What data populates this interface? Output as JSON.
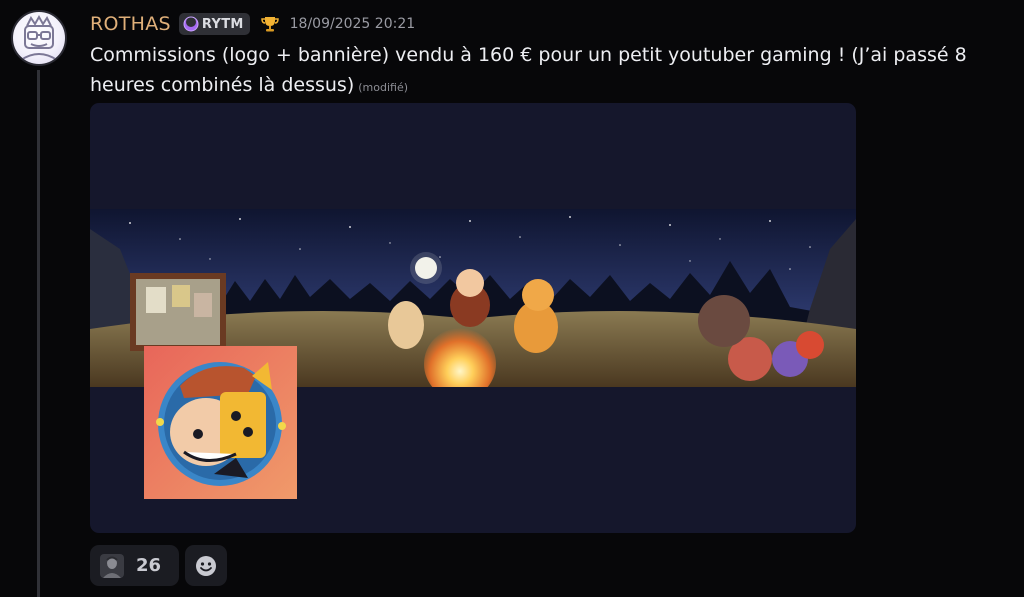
{
  "message": {
    "author": "ROTHAS",
    "tag": {
      "label": "RYTM",
      "icon": "purple-crescent-icon"
    },
    "badge_icon": "trophy-icon",
    "timestamp": "18/09/2025 20:21",
    "text": "Commissions (logo + bannière) vendu à 160 € pour un petit youtuber gaming ! (J’ai passé 8 heures combinés là dessus)",
    "edited_label": "(modifié)",
    "colors": {
      "author": "#e0b07a",
      "text": "#edeef2",
      "attachment_bg": "#15172c"
    }
  },
  "attachment": {
    "banner_icon": "campfire-night-banner-image",
    "logo_icon": "character-logo-image"
  },
  "reactions": {
    "count": "26",
    "avatar_icon": "user-avatar-icon",
    "add_icon": "smiley-add-reaction-icon"
  }
}
